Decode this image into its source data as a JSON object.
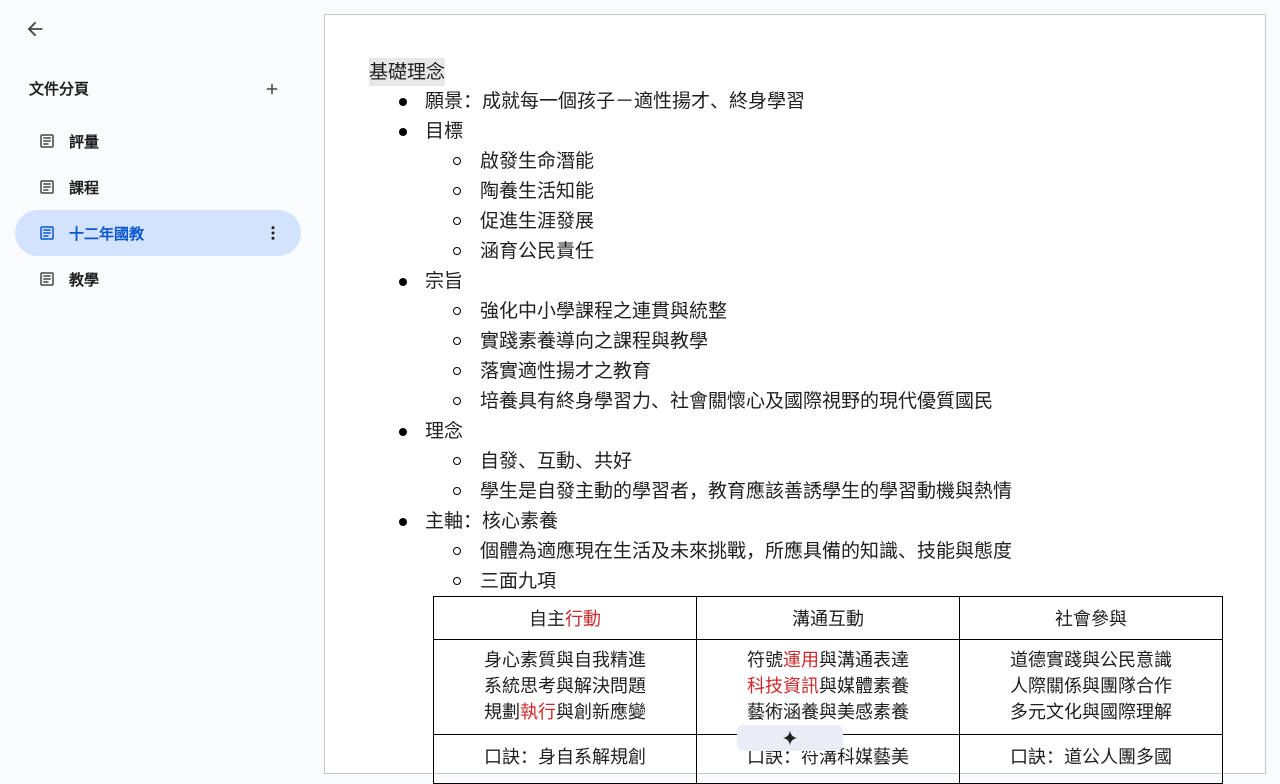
{
  "sidebar": {
    "title": "文件分頁",
    "tabs": [
      {
        "label": "評量",
        "active": false
      },
      {
        "label": "課程",
        "active": false
      },
      {
        "label": "十二年國教",
        "active": true
      },
      {
        "label": "教學",
        "active": false
      }
    ]
  },
  "document": {
    "heading": "基礎理念",
    "list": [
      {
        "text": "願景：成就每一個孩子－適性揚才、終身學習",
        "children": []
      },
      {
        "text": "目標",
        "children": [
          "啟發生命潛能",
          "陶養生活知能",
          "促進生涯發展",
          "涵育公民責任"
        ]
      },
      {
        "text": "宗旨",
        "children": [
          "強化中小學課程之連貫與統整",
          "實踐素養導向之課程與教學",
          "落實適性揚才之教育",
          "培養具有終身學習力、社會關懷心及國際視野的現代優質國民"
        ]
      },
      {
        "text": "理念",
        "children": [
          "自發、互動、共好",
          "學生是自發主動的學習者，教育應該善誘學生的學習動機與熱情"
        ]
      },
      {
        "text": "主軸：核心素養",
        "children": [
          "個體為適應現在生活及未來挑戰，所應具備的知識、技能與態度",
          "三面九項"
        ]
      }
    ],
    "table": {
      "headers": [
        {
          "plain": "自主",
          "red": "行動",
          "after": ""
        },
        {
          "plain": "溝通互動",
          "red": "",
          "after": ""
        },
        {
          "plain": "社會參與",
          "red": "",
          "after": ""
        }
      ],
      "cells": [
        [
          {
            "plain": "身心素質與自我精進",
            "red": "",
            "after": ""
          },
          {
            "plain": "系統思考與解決問題",
            "red": "",
            "after": ""
          },
          {
            "plain": "規劃",
            "red": "執行",
            "after": "與創新應變"
          }
        ],
        [
          {
            "plain": "符號",
            "red": "運用",
            "after": "與溝通表達"
          },
          {
            "plain": "",
            "red": "科技資訊",
            "after": "與媒體素養"
          },
          {
            "plain": "藝術涵養與美感素養",
            "red": "",
            "after": ""
          }
        ],
        [
          {
            "plain": "道德實踐與公民意識",
            "red": "",
            "after": ""
          },
          {
            "plain": "人際關係與團隊合作",
            "red": "",
            "after": ""
          },
          {
            "plain": "多元文化與國際理解",
            "red": "",
            "after": ""
          }
        ]
      ],
      "mnemonics": [
        "口訣：身自系解規創",
        "口訣：符溝科媒藝美",
        "口訣：道公人團多國"
      ]
    }
  },
  "colors": {
    "accent": "#0b57d0",
    "active_tab_bg": "#d3e3fd",
    "red_text": "#cc2929"
  },
  "icons": {
    "back": "arrow-back-icon",
    "add": "plus-icon",
    "doc": "document-icon",
    "more": "more-vert-icon",
    "sparkle": "sparkle-icon"
  }
}
